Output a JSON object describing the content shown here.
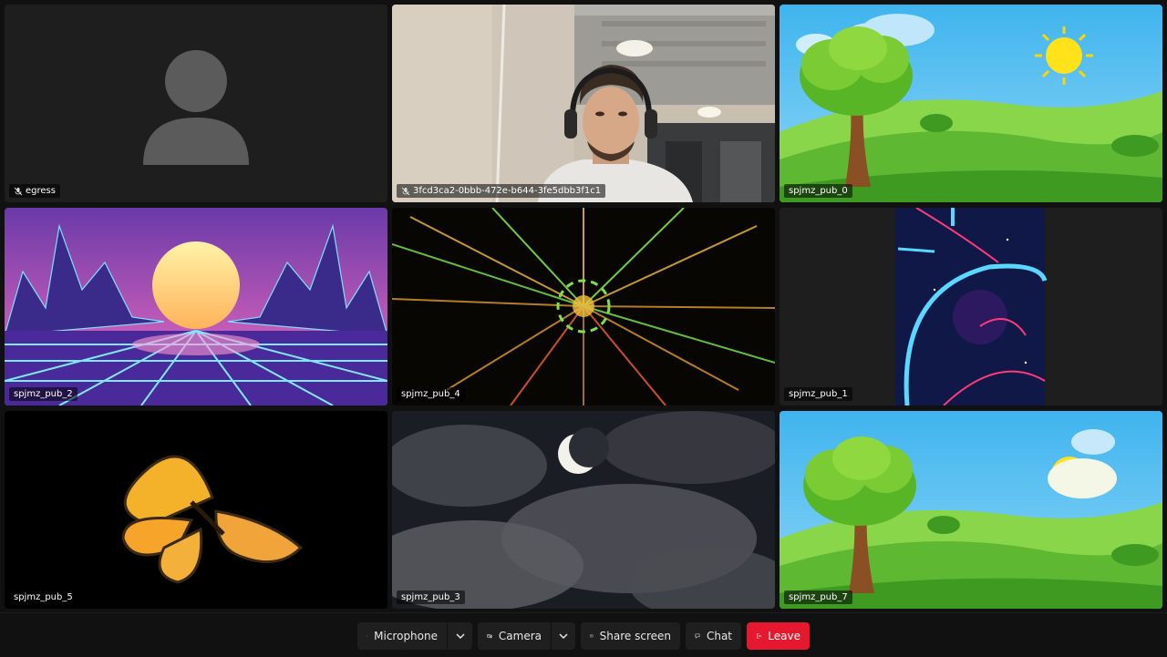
{
  "participants": [
    {
      "name": "egress",
      "muted": true,
      "scene": "avatar"
    },
    {
      "name": "3fcd3ca2-0bbb-472e-b644-3fe5dbb3f1c1",
      "muted": true,
      "scene": "camera"
    },
    {
      "name": "spjmz_pub_0",
      "muted": false,
      "scene": "meadow"
    },
    {
      "name": "spjmz_pub_2",
      "muted": false,
      "scene": "synthwave"
    },
    {
      "name": "spjmz_pub_4",
      "muted": false,
      "scene": "tunnel"
    },
    {
      "name": "spjmz_pub_1",
      "muted": false,
      "scene": "neon-portal"
    },
    {
      "name": "spjmz_pub_5",
      "muted": false,
      "scene": "butterfly"
    },
    {
      "name": "spjmz_pub_3",
      "muted": false,
      "scene": "moon-clouds"
    },
    {
      "name": "spjmz_pub_7",
      "muted": false,
      "scene": "meadow"
    }
  ],
  "controls": {
    "microphone_label": "Microphone",
    "camera_label": "Camera",
    "share_label": "Share screen",
    "chat_label": "Chat",
    "leave_label": "Leave"
  },
  "colors": {
    "leave": "#e5182f",
    "control_bg": "#1f1f1f",
    "tile_bg": "#1e1e1e"
  },
  "icons": [
    "microphone-off-icon",
    "camera-off-icon",
    "share-screen-icon",
    "chat-icon",
    "leave-icon",
    "chevron-down-icon"
  ]
}
